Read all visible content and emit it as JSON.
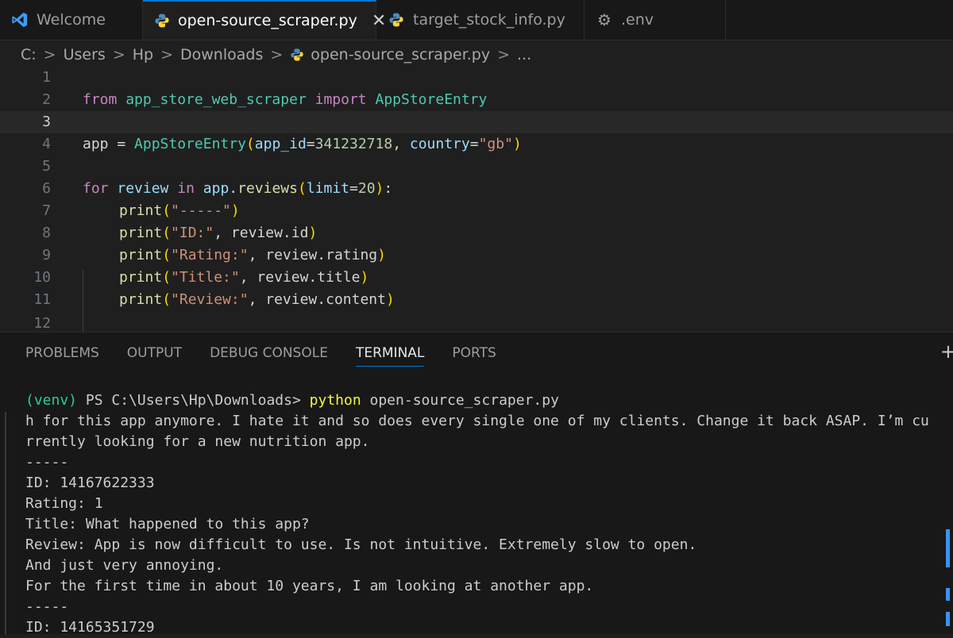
{
  "tabs": [
    {
      "label": "Welcome",
      "icon": "vscode-icon",
      "active": false
    },
    {
      "label": "open-source_scraper.py",
      "icon": "python-icon",
      "active": true,
      "close": "✕"
    },
    {
      "label": "target_stock_info.py",
      "icon": "python-icon",
      "active": false
    },
    {
      "label": ".env",
      "icon": "gear-icon",
      "active": false
    }
  ],
  "breadcrumb": {
    "items": [
      "C:",
      "Users",
      "Hp",
      "Downloads",
      "open-source_scraper.py",
      "..."
    ],
    "separator": ">"
  },
  "editor": {
    "line_numbers": [
      "1",
      "2",
      "3",
      "4",
      "5",
      "6",
      "7",
      "8",
      "9",
      "10",
      "11",
      "12"
    ],
    "line2": {
      "from": "from",
      "module": "app_store_web_scraper",
      "import": "import",
      "cls": "AppStoreEntry"
    },
    "line4": {
      "app": "app",
      "eq": " = ",
      "cls": "AppStoreEntry",
      "p1": "(",
      "arg1": "app_id",
      "eq1": "=",
      "num": "341232718",
      "comma": ", ",
      "arg2": "country",
      "eq2": "=",
      "str": "\"gb\"",
      "p2": ")"
    },
    "line6": {
      "for": "for",
      "review": "review",
      "in": "in",
      "app": "app",
      "dot": ".",
      "reviews": "reviews",
      "p1": "(",
      "arg": "limit",
      "eq": "=",
      "num": "20",
      "p2": ")",
      "colon": ":"
    },
    "prints": [
      {
        "fn": "print",
        "p1": "(",
        "str": "\"-----\"",
        "rest": "",
        "p2": ")"
      },
      {
        "fn": "print",
        "p1": "(",
        "str": "\"ID:\"",
        "rest": ", review.id",
        "p2": ")"
      },
      {
        "fn": "print",
        "p1": "(",
        "str": "\"Rating:\"",
        "rest": ", review.rating",
        "p2": ")"
      },
      {
        "fn": "print",
        "p1": "(",
        "str": "\"Title:\"",
        "rest": ", review.title",
        "p2": ")"
      },
      {
        "fn": "print",
        "p1": "(",
        "str": "\"Review:\"",
        "rest": ", review.content",
        "p2": ")"
      }
    ]
  },
  "panel": {
    "tabs": [
      "PROBLEMS",
      "OUTPUT",
      "DEBUG CONSOLE",
      "TERMINAL",
      "PORTS"
    ],
    "active": "TERMINAL",
    "plus": "+"
  },
  "terminal": {
    "prompt_venv": "(venv)",
    "prompt_path": " PS C:\\Users\\Hp\\Downloads> ",
    "prompt_cmd": "python",
    "prompt_arg": " open-source_scraper.py",
    "lines": [
      "h for this app anymore. I hate it and so does every single one of my clients. Change it back ASAP. I’m cu",
      "rrently looking for a new nutrition app.",
      "-----",
      "ID: 14167622333",
      "Rating: 1",
      "Title: What happened to this app?",
      "Review: App is now difficult to use. Is not intuitive. Extremely slow to open.",
      "And just very annoying.",
      "For the first time in about 10 years, I am looking at another app.",
      "-----",
      "ID: 14165351729"
    ]
  },
  "colors": {
    "accent": "#0078d4",
    "python_blue": "#3572A5",
    "python_yellow": "#ffd43b"
  }
}
